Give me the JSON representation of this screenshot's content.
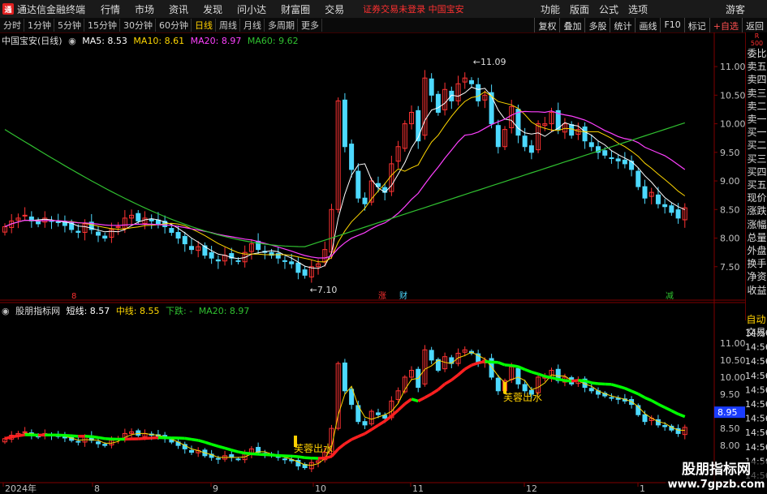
{
  "app": {
    "name": "通达信金融终端",
    "logo": "通"
  },
  "menu": [
    "行情",
    "市场",
    "资讯",
    "发现",
    "问小达",
    "财富圈",
    "交易"
  ],
  "warning": "证券交易未登录  中国宝安",
  "right_menu": [
    "功能",
    "版面",
    "公式",
    "选项"
  ],
  "guest": "游客",
  "periods": [
    "分时",
    "1分钟",
    "5分钟",
    "15分钟",
    "30分钟",
    "60分钟",
    "日线",
    "周线",
    "月线",
    "多周期",
    "更多"
  ],
  "active_period": "日线",
  "tools": [
    "复权",
    "叠加",
    "多股",
    "统计",
    "画线",
    "F10",
    "标记",
    "+自选",
    "返回"
  ],
  "r_badge": {
    "r": "R",
    "n": "500"
  },
  "main_legend": {
    "title": "中国宝安(日线)",
    "ma5": "MA5: 8.53",
    "ma10": "MA10: 8.61",
    "ma20": "MA20: 8.97",
    "ma60": "MA60: 9.62"
  },
  "sub_legend": {
    "title": "股朋指标网",
    "short": "短线: 8.57",
    "mid": "中线: 8.55",
    "down": "下跌: -",
    "ma20": "MA20: 8.97"
  },
  "right_panel": [
    "委比",
    "卖五",
    "卖四",
    "卖三",
    "卖二",
    "卖一",
    "买一",
    "买二",
    "买三",
    "买四",
    "买五",
    "现价",
    "涨跌",
    "涨幅",
    "总量",
    "外盘",
    "换手",
    "净资",
    "收益"
  ],
  "right_panel2": [
    "自动",
    "交易"
  ],
  "price_axis_main": [
    "11.00",
    "10.50",
    "10.00",
    "9.50",
    "9.00",
    "8.50",
    "8.00",
    "7.50"
  ],
  "price_axis_sub": [
    "11.00",
    "10.50",
    "10.00",
    "9.50",
    "9.00",
    "8.50",
    "8.00"
  ],
  "sub_time_labels": [
    "14:56",
    "14:56",
    "14:56",
    "14:56",
    "14:56",
    "14:56",
    "14:56",
    "14:56",
    "14:56",
    "14:56",
    "14:56"
  ],
  "current_price_tag": "8.95",
  "annotations": {
    "high": "11.09",
    "low": "7.10",
    "signal": "芙蓉出水"
  },
  "event_markers": {
    "m1": "8",
    "zhang": "涨",
    "cai": "财",
    "jian": "减"
  },
  "x_axis": [
    "2024年",
    "8",
    "9",
    "10",
    "11",
    "12",
    "1"
  ],
  "watermark": {
    "line1": "股朋指标网",
    "line2": "www.7gpzb.com"
  },
  "colors": {
    "up": "#ff3333",
    "down": "#4dd9ff",
    "ma5": "#ffffff",
    "ma10": "#ffd700",
    "ma20": "#ff40ff",
    "ma60": "#30c030",
    "bull": "#00ff00",
    "bear": "#ff2020"
  },
  "chart_data": {
    "type": "candlestick",
    "price_range_main": [
      7.0,
      11.2
    ],
    "closes": [
      8.2,
      8.3,
      8.35,
      8.4,
      8.3,
      8.25,
      8.35,
      8.3,
      8.28,
      8.22,
      8.15,
      8.1,
      8.25,
      8.15,
      8.05,
      8.0,
      8.15,
      8.2,
      8.35,
      8.4,
      8.3,
      8.35,
      8.3,
      8.25,
      8.2,
      8.1,
      8.0,
      7.9,
      7.8,
      7.85,
      7.7,
      7.65,
      7.6,
      7.7,
      7.65,
      7.6,
      7.75,
      7.9,
      7.8,
      7.75,
      7.7,
      7.65,
      7.6,
      7.55,
      7.4,
      7.35,
      7.5,
      7.55,
      7.8,
      8.5,
      10.4,
      9.6,
      9.2,
      8.7,
      8.6,
      9.0,
      8.9,
      8.8,
      9.3,
      9.6,
      10.0,
      10.2,
      9.7,
      10.8,
      10.5,
      10.2,
      10.6,
      10.4,
      10.7,
      10.8,
      10.7,
      10.4,
      10.5,
      10.0,
      9.6,
      9.9,
      10.3,
      9.8,
      9.6,
      9.5,
      10.0,
      10.0,
      10.2,
      9.9,
      10.0,
      9.8,
      9.9,
      9.7,
      9.6,
      9.5,
      9.45,
      9.4,
      9.35,
      9.3,
      9.2,
      8.9,
      8.7,
      8.8,
      8.6,
      8.55,
      8.45,
      8.35,
      8.53
    ],
    "ma60_last": 9.62
  }
}
